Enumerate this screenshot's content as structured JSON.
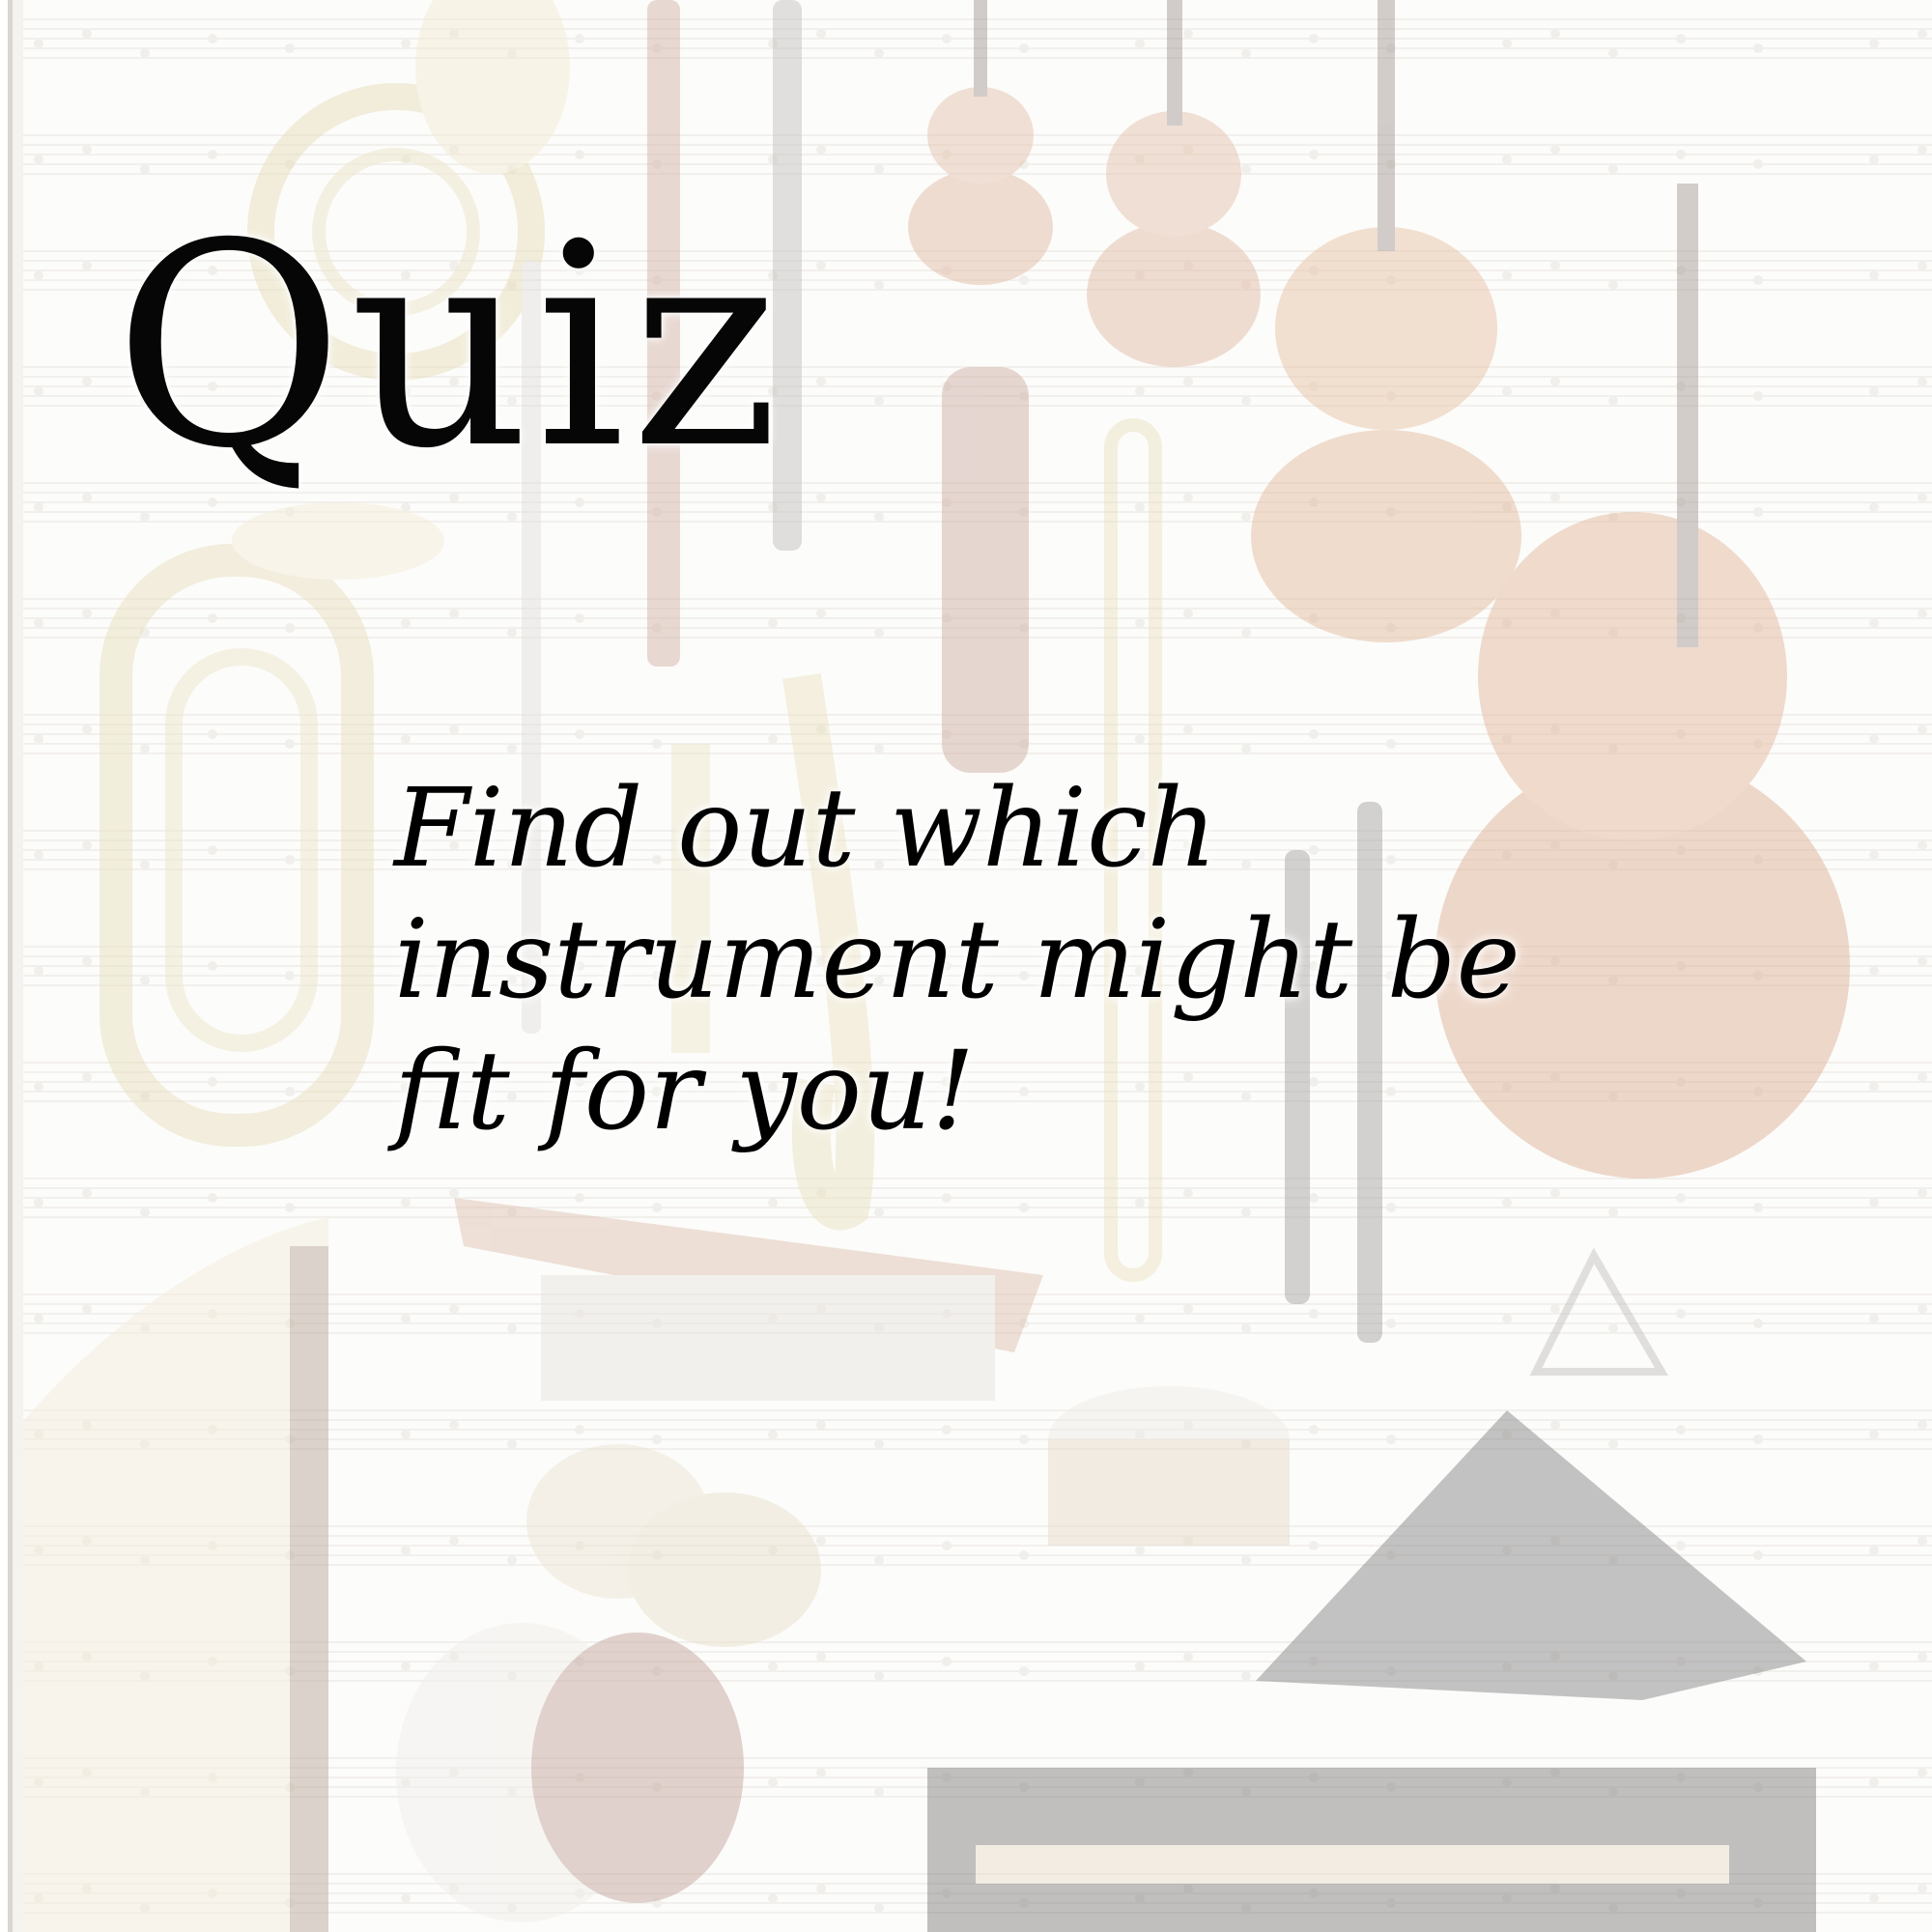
{
  "slide": {
    "title": "Quiz",
    "subtitle": "Find out which instrument might be fit for you!"
  },
  "background": {
    "description_icon": "orchestra-instruments-poster",
    "instruments": [
      "french-horn-icon",
      "bassoon-icon",
      "bass-clarinet-icon",
      "violin-icon",
      "viola-icon",
      "cello-icon",
      "double-bass-icon",
      "tuba-icon",
      "flute-icon",
      "contrabassoon-icon",
      "trumpet-icon",
      "alto-saxophone-icon",
      "trombone-icon",
      "clarinet-icon",
      "oboe-icon",
      "harp-icon",
      "marimba-icon",
      "snare-drum-icon",
      "triangle-icon",
      "cymbals-icon",
      "bass-drum-icon",
      "grand-piano-icon"
    ],
    "colors": {
      "brass": "#e3d7a9",
      "wood": "#d89c6e",
      "dark": "#b7b2ae",
      "paper": "#fbfaf8"
    }
  }
}
